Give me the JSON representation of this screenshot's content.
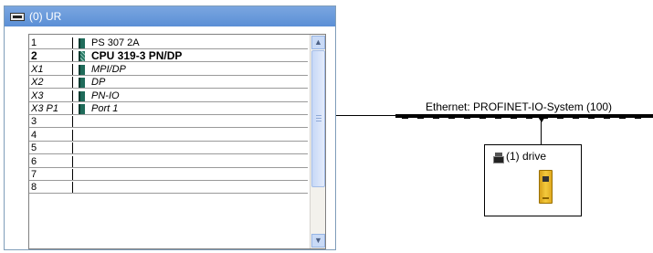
{
  "rack": {
    "title": "(0) UR",
    "rows": [
      {
        "slot": "1",
        "name": "PS 307 2A",
        "style": "normal",
        "icon": "module"
      },
      {
        "slot": "2",
        "name": "CPU 319-3 PN/DP",
        "style": "bold",
        "icon": "cpu"
      },
      {
        "slot": "X1",
        "name": "MPI/DP",
        "style": "italic",
        "icon": "module"
      },
      {
        "slot": "X2",
        "name": "DP",
        "style": "italic",
        "icon": "module"
      },
      {
        "slot": "X3",
        "name": "PN-IO",
        "style": "italic",
        "icon": "module"
      },
      {
        "slot": "X3 P1",
        "name": "Port 1",
        "style": "italic",
        "icon": "module"
      },
      {
        "slot": "3",
        "name": "",
        "style": "normal",
        "icon": ""
      },
      {
        "slot": "4",
        "name": "",
        "style": "normal",
        "icon": ""
      },
      {
        "slot": "5",
        "name": "",
        "style": "normal",
        "icon": ""
      },
      {
        "slot": "6",
        "name": "",
        "style": "normal",
        "icon": ""
      },
      {
        "slot": "7",
        "name": "",
        "style": "normal",
        "icon": ""
      },
      {
        "slot": "8",
        "name": "",
        "style": "normal",
        "icon": ""
      }
    ]
  },
  "network": {
    "label": "Ethernet: PROFINET-IO-System (100)"
  },
  "device": {
    "label": "(1) drive",
    "icon": "io-device-icon"
  },
  "colors": {
    "titlebar": "#6b9ae0",
    "scrollbar": "#c9daf6",
    "drive": "#f0c030"
  }
}
